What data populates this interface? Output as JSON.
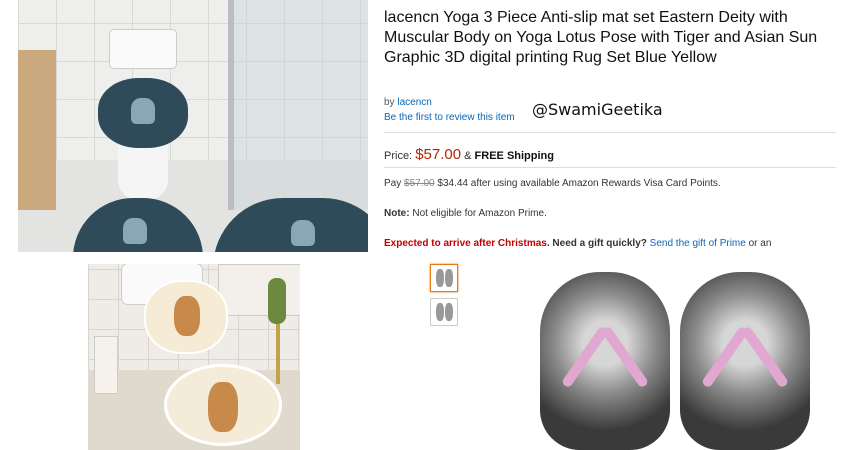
{
  "product": {
    "title": "lacencn Yoga 3 Piece Anti-slip mat set Eastern Deity with Muscular Body on Yoga Lotus Pose with Tiger and Asian Sun Graphic 3D digital printing Rug Set Blue Yellow",
    "by_prefix": "by",
    "brand": "lacencn",
    "review_link": "Be the first to review this item",
    "price_label": "Price:",
    "price": "$57.00",
    "shipping_prefix": "&",
    "shipping": "FREE Shipping",
    "pay_prefix": "Pay",
    "pay_old": "$57.00",
    "pay_new": "$34.44",
    "pay_suffix": "after using available Amazon Rewards Visa Card Points.",
    "note_label": "Note:",
    "note_text": "Not eligible for Amazon Prime.",
    "arrival": "Expected to arrive after Christmas.",
    "gift_question": "Need a gift quickly?",
    "gift_link": "Send the gift of Prime",
    "gift_suffix": "or an"
  },
  "overlay": {
    "handle": "@SwamiGeetika"
  },
  "colors": {
    "price": "#b12704",
    "link": "#0a66b7",
    "alert": "#c40000",
    "mat_blue": "#2f4b5a",
    "strap_pink": "#e0a8d0"
  },
  "thumbnails": [
    {
      "icon": "flip-flop-thumbnail",
      "selected": true
    },
    {
      "icon": "flip-flop-thumbnail",
      "selected": false
    }
  ]
}
